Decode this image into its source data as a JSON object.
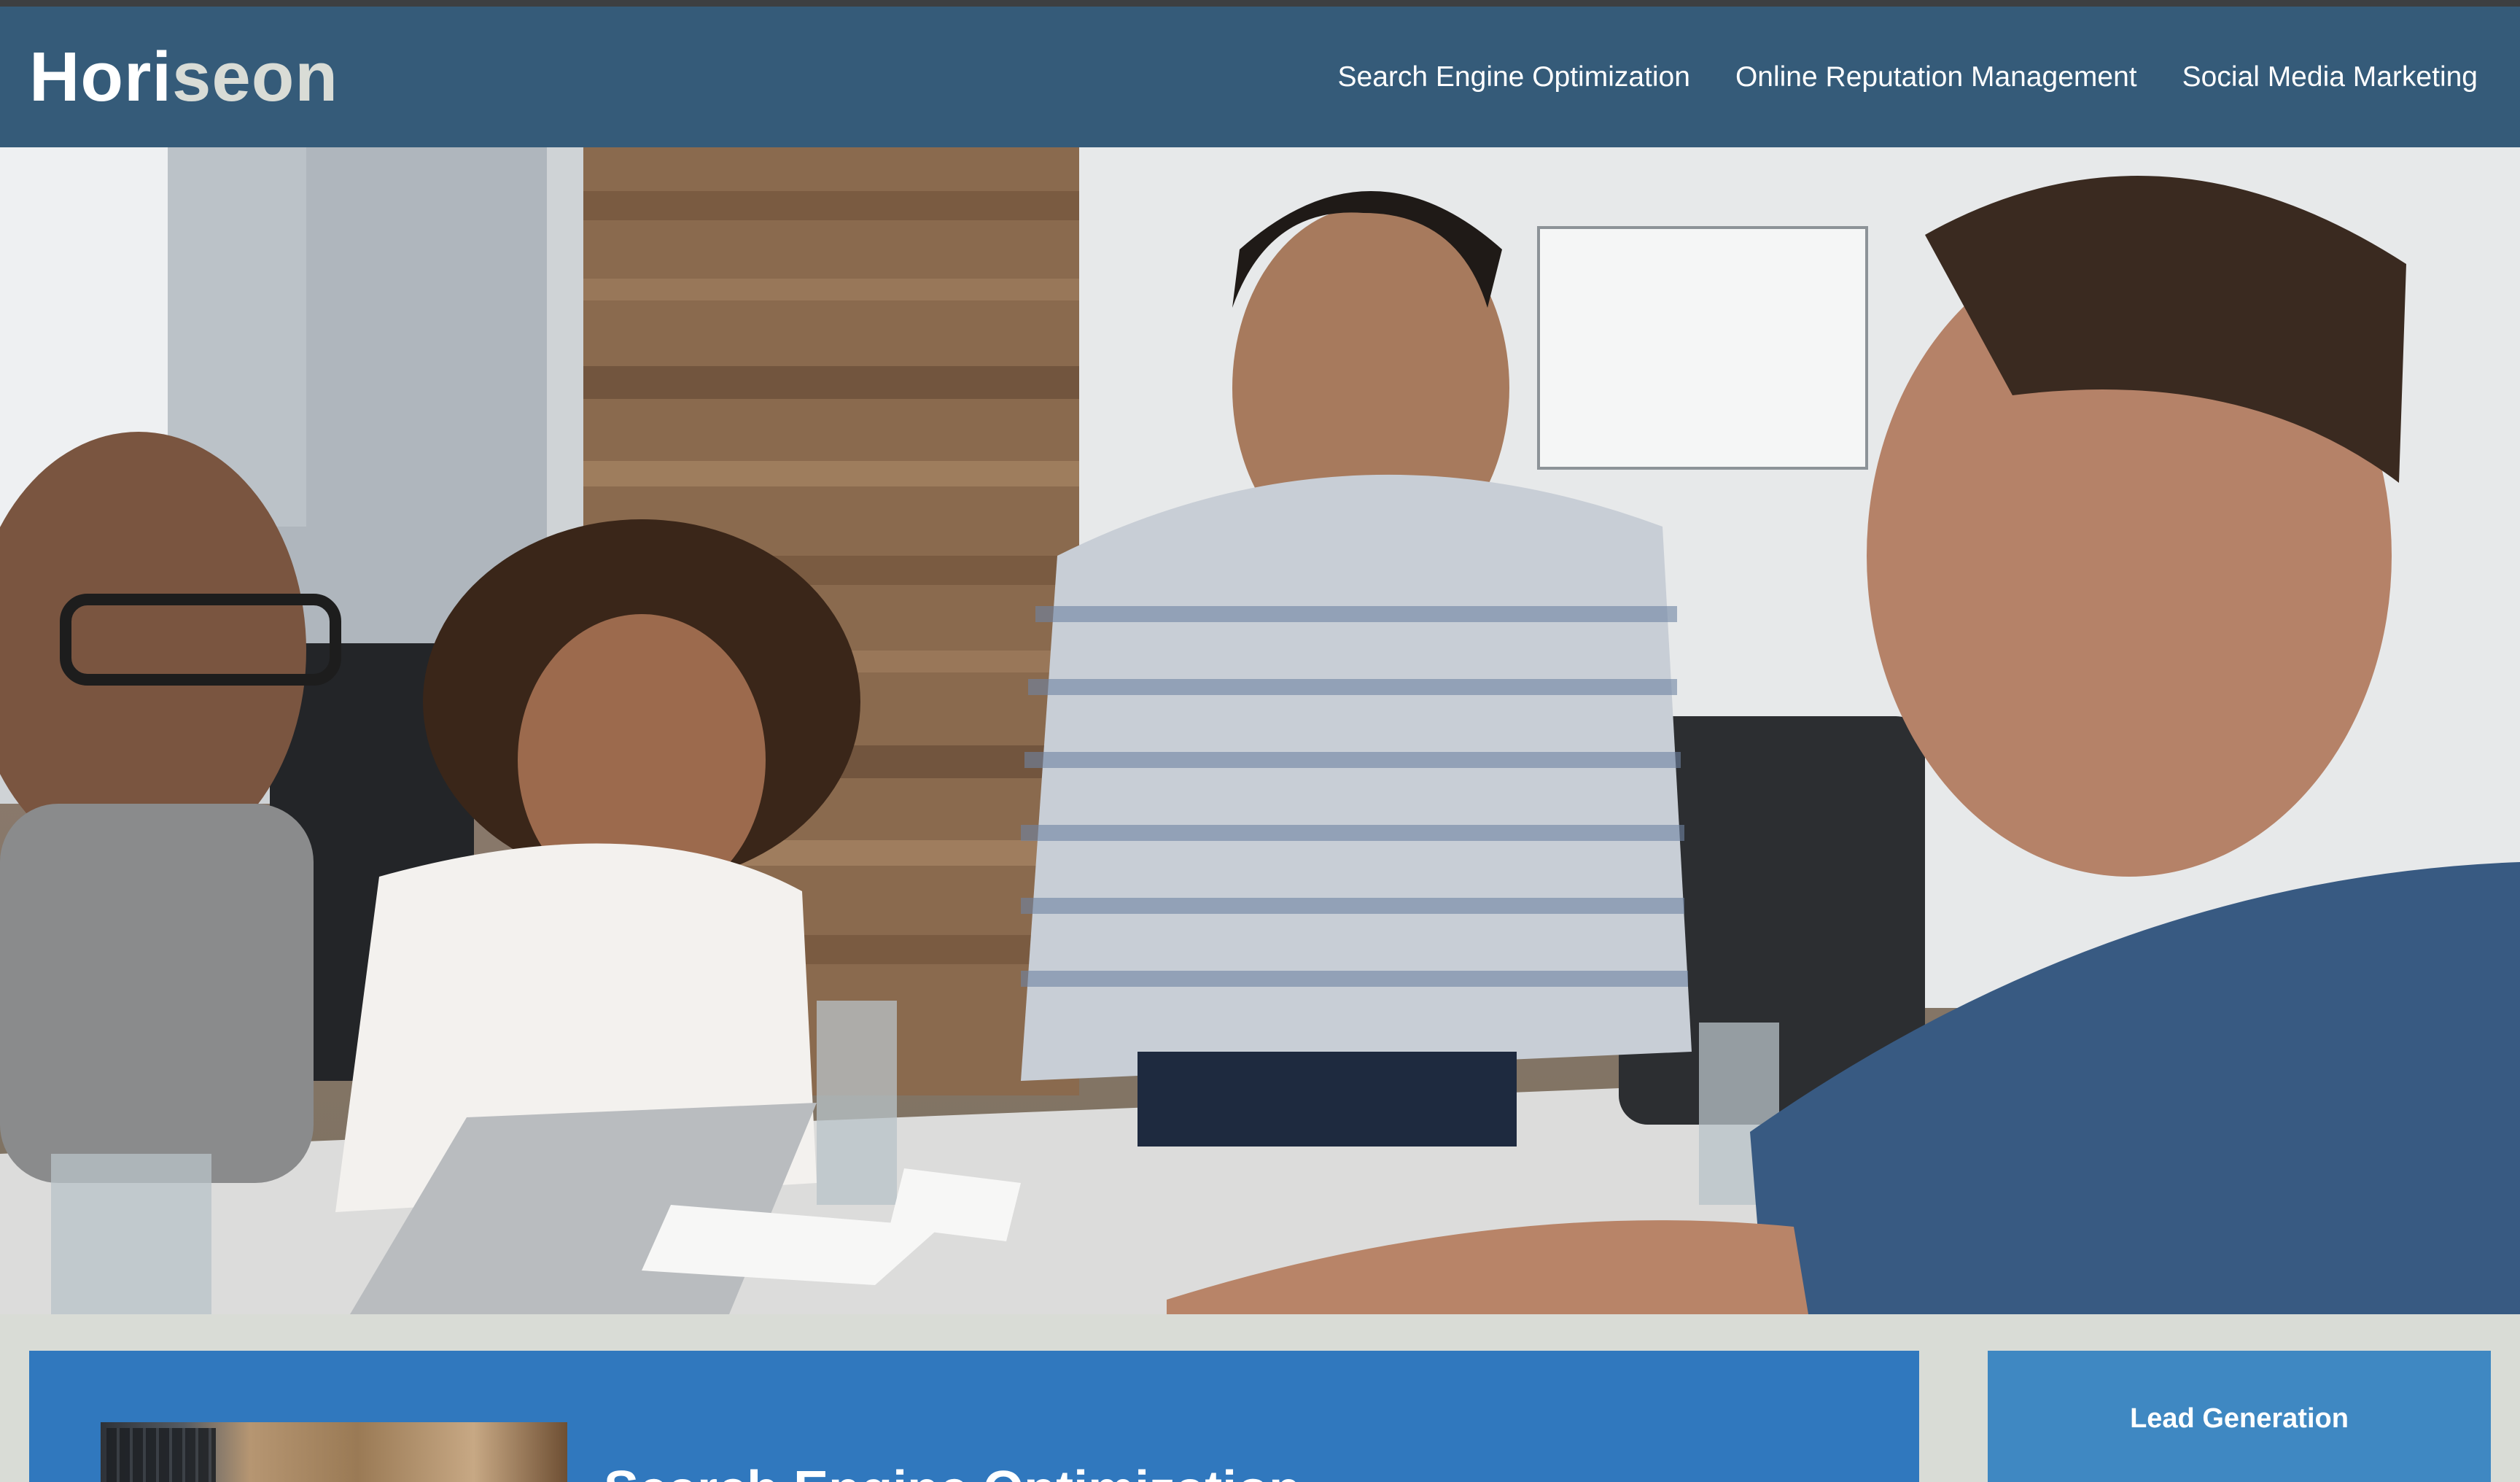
{
  "header": {
    "logo_main": "Hori",
    "logo_accent": "seon",
    "nav": [
      {
        "label": "Search Engine Optimization"
      },
      {
        "label": "Online Reputation Management"
      },
      {
        "label": "Social Media Marketing"
      }
    ]
  },
  "hero": {
    "icon": "team-meeting-photo"
  },
  "content": {
    "seo_card": {
      "title": "Search Engine Optimization",
      "image_icon": "laptop-desk-photo"
    },
    "lead_card": {
      "title": "Lead Generation"
    }
  },
  "colors": {
    "header_bg": "#355b79",
    "page_bg": "#d9dcd6",
    "card_blue": "#3078be",
    "sidebar_blue": "#3f88c2"
  }
}
